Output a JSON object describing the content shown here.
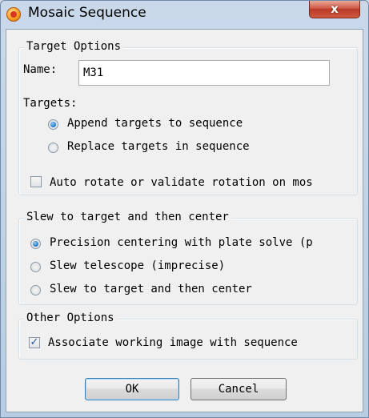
{
  "window": {
    "title": "Mosaic Sequence",
    "close_glyph": "x"
  },
  "target_options": {
    "title": "Target Options",
    "name_label": "Name:",
    "name_value": "M31",
    "targets_label": "Targets:",
    "radios": [
      {
        "label": "Append targets to sequence",
        "selected": true
      },
      {
        "label": "Replace targets in sequence",
        "selected": false
      }
    ],
    "auto_rotate": {
      "label": "Auto rotate or validate rotation on mos",
      "checked": false
    }
  },
  "slew": {
    "title": "Slew to target and then center",
    "radios": [
      {
        "label": "Precision centering with plate solve (p",
        "selected": true
      },
      {
        "label": "Slew telescope (imprecise)",
        "selected": false
      },
      {
        "label": "Slew to target and then center",
        "selected": false
      }
    ]
  },
  "other_options": {
    "title": "Other Options",
    "associate": {
      "label": "Associate working image with sequence",
      "checked": true,
      "check_glyph": "✓"
    }
  },
  "buttons": {
    "ok": "OK",
    "cancel": "Cancel"
  }
}
